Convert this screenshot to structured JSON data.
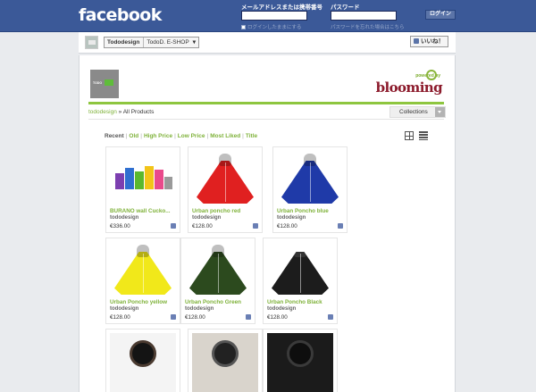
{
  "fb": {
    "logo": "facebook",
    "email_label": "メールアドレスまたは携帯番号",
    "password_label": "パスワード",
    "email_value": "",
    "password_value": "",
    "keep_logged_in": "ログインしたままにする",
    "forgot_password": "パスワードを忘れた場合はこちら",
    "login_button": "ログイン"
  },
  "page": {
    "name": "Tododesign",
    "tab": "TodoD. E-SHOP",
    "like_button": "いいね！"
  },
  "shop": {
    "logo_text": "TODO",
    "powered_by": "powered by",
    "blooming": "blooming",
    "breadcrumb_link": "tododesign",
    "breadcrumb_sep": " » ",
    "breadcrumb_current": "All Products",
    "collections": "Collections",
    "sort": {
      "recent": "Recent",
      "old": "Old",
      "high": "High Price",
      "low": "Low Price",
      "most_liked": "Most Liked",
      "title": "Title"
    },
    "products": [
      {
        "name": "BURANO wall Cucko...",
        "vendor": "tododesign",
        "price": "€336.00"
      },
      {
        "name": "Urban poncho red",
        "vendor": "tododesign",
        "price": "€128.00",
        "color": "#e02020"
      },
      {
        "name": "Urban Poncho blue",
        "vendor": "tododesign",
        "price": "€128.00",
        "color": "#1f3aa8"
      },
      {
        "name": "Urban Poncho yellow",
        "vendor": "tododesign",
        "price": "€128.00",
        "color": "#f1e81a"
      },
      {
        "name": "Urban Poncho Green",
        "vendor": "tododesign",
        "price": "€128.00",
        "color": "#2c4a1e"
      },
      {
        "name": "Urban Poncho Black",
        "vendor": "tododesign",
        "price": "€128.00",
        "color": "#1c1c1c"
      }
    ]
  },
  "colors": {
    "fb_blue": "#3b5998",
    "accent_green": "#8ec63f",
    "link_green": "#7fb23a",
    "blooming_red": "#8c1b2c"
  }
}
